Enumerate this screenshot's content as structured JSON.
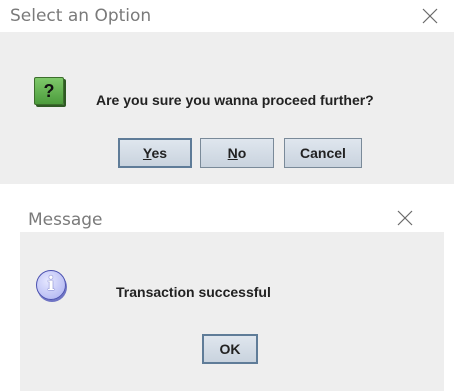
{
  "confirm_dialog": {
    "title": "Select an Option",
    "message": "Are you sure you wanna proceed further?",
    "icon_glyph": "?",
    "icon": "question-icon",
    "buttons": {
      "yes_prefix": "",
      "yes_mnemonic": "Y",
      "yes_rest": "es",
      "no_mnemonic": "N",
      "no_rest": "o",
      "cancel": "Cancel"
    }
  },
  "message_dialog": {
    "title": "Message",
    "message": "Transaction successful",
    "icon_glyph": "i",
    "icon": "info-icon",
    "buttons": {
      "ok": "OK"
    }
  },
  "colors": {
    "dialog_bg": "#eeeeee",
    "titlebar_bg": "#ffffff",
    "title_text": "#7a7a7a",
    "question_icon_green": "#4c9c3c",
    "info_icon_blue": "#4b51b0",
    "button_border": "#7a8a99"
  }
}
